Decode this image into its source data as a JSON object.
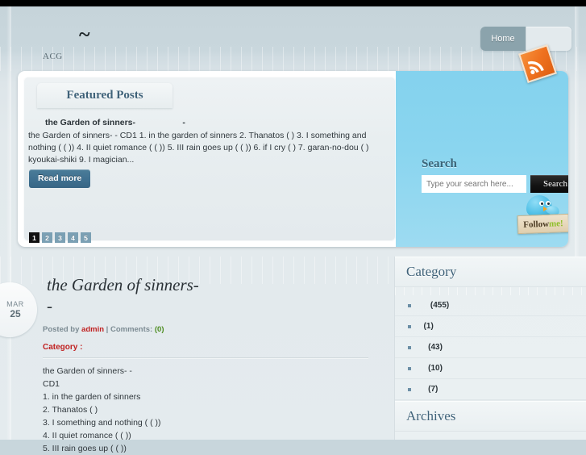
{
  "site": {
    "logo": "~",
    "subnav_label": "ACG",
    "rss_icon": "rss-icon"
  },
  "nav": {
    "items": [
      {
        "label": "Home",
        "active": true
      },
      {
        "label": "",
        "active": false
      }
    ]
  },
  "featured": {
    "tab_label": "Featured Posts",
    "post_title": "the Garden of sinners-                    -",
    "post_excerpt": "the Garden of sinners-             - CD1 1. in the garden of sinners 2. Thanatos (    ) 3. I something and nothing (    ( )) 4. II quiet romance (    ( )) 5. III rain goes up (     ( )) 6. if I cry (    ) 7. garan-no-dou (    ) kyoukai-shiki 9. I magician...",
    "read_more_label": "Read more",
    "pager": [
      {
        "label": "1",
        "active": true
      },
      {
        "label": "2",
        "active": false
      },
      {
        "label": "3",
        "active": false
      },
      {
        "label": "4",
        "active": false
      },
      {
        "label": "5",
        "active": false
      }
    ]
  },
  "search": {
    "title": "Search",
    "placeholder": "Type your search here...",
    "value": "",
    "button_label": "Search"
  },
  "follow": {
    "text_dark": "Follow",
    "text_accent": "me!",
    "icon": "twitter-bird-icon"
  },
  "post": {
    "date_month": "MAR",
    "date_day": "25",
    "title": "the Garden of sinners-\n                    -",
    "meta_prefix": "Posted by ",
    "author": "admin",
    "meta_middle": " | Comments: ",
    "comment_count": "(0)",
    "category_label": "Category :",
    "body": "the Garden of sinners-             -\nCD1\n1. in the garden of sinners\n2. Thanatos (    )\n3. I something and nothing (    ( ))\n4. II quiet romance (    ( ))\n5. III rain goes up (     ( ))"
  },
  "sidebar": {
    "category_title": "Category",
    "categories": [
      {
        "label": "     (455)"
      },
      {
        "label": "  (1)"
      },
      {
        "label": "    (43)"
      },
      {
        "label": "    (10)"
      },
      {
        "label": "    (7)"
      }
    ],
    "archives_title": "Archives"
  },
  "colors": {
    "page_bg": "#c8d6dc",
    "accent_blue": "#3f6279",
    "featured_panel_blue": "#8ad5ef",
    "button_blue": "#3f7090",
    "author_red": "#c02020",
    "comment_green": "#4c8c1f",
    "rss_orange": "#ef7220"
  }
}
